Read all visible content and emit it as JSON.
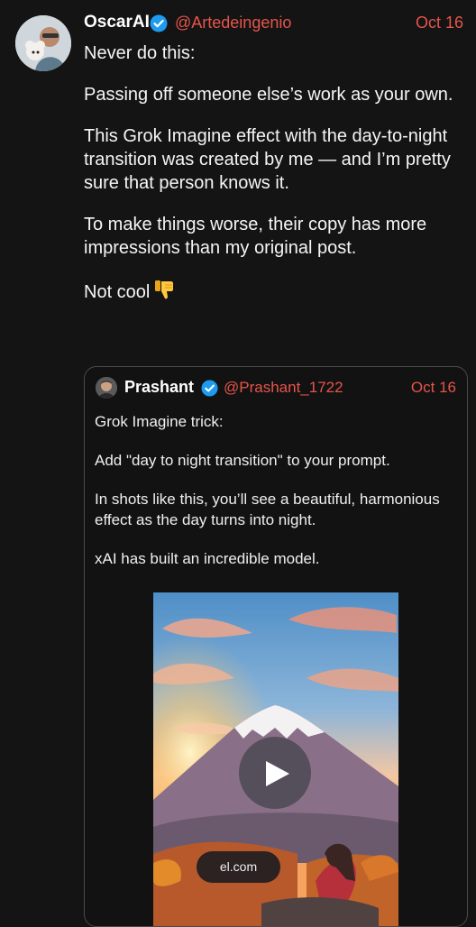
{
  "post": {
    "author_name": "OscarAI",
    "handle": "@Artedeingenio",
    "date": "Oct 16",
    "paragraphs": [
      "Never do this:",
      "Passing off someone else’s work as your own.",
      "This Grok Imagine effect with the day-to-night transition was created by me — and I’m pretty sure that person knows it.",
      "To make things worse, their copy has more impressions than my original post."
    ],
    "closing": "Not cool",
    "closing_emoji": "thumbs-down-icon"
  },
  "quoted": {
    "author_name": "Prashant",
    "handle": "@Prashant_1722",
    "date": "Oct 16",
    "paragraphs": [
      "Grok Imagine trick:",
      "Add \"day to night transition\" to your prompt.",
      "In shots like this, you’ll see a beautiful, harmonious effect as the day turns into night.",
      "xAI has built an incredible model."
    ],
    "media": {
      "url_label": "el.com",
      "play_icon": "play-icon"
    }
  },
  "colors": {
    "background": "#141414",
    "accent": "#e5554a",
    "verified": "#1d9bf0"
  }
}
